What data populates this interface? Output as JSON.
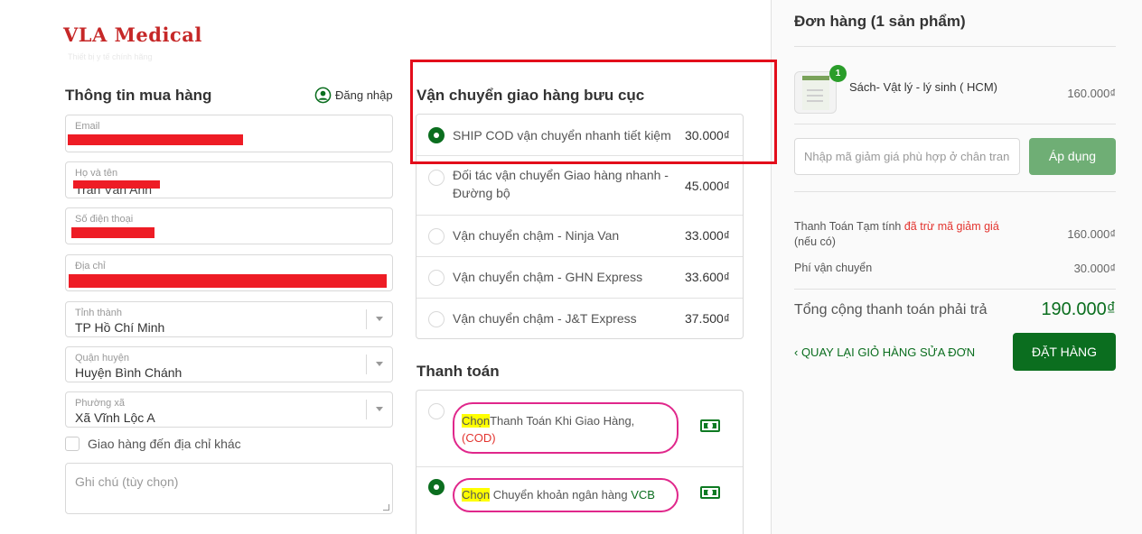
{
  "brand": {
    "logo": "VLA Medical",
    "tagline": "Thiết bị y tế chính hãng"
  },
  "checkout_info": {
    "title": "Thông tin mua hàng",
    "login_label": "Đăng nhập",
    "fields": {
      "email_label": "Email",
      "name_label": "Họ và tên",
      "name_value": "Trần Văn Anh",
      "phone_label": "Số điện thoại",
      "address_label": "Địa chỉ",
      "province_label": "Tỉnh thành",
      "province_value": "TP Hồ Chí Minh",
      "district_label": "Quận huyện",
      "district_value": "Huyện Bình Chánh",
      "ward_label": "Phường xã",
      "ward_value": "Xã Vĩnh Lộc A"
    },
    "other_address_label": "Giao hàng đến địa chỉ khác",
    "note_placeholder": "Ghi chú (tùy chọn)"
  },
  "shipping": {
    "title": "Vận chuyển giao hàng bưu cục",
    "options": [
      {
        "name": "SHIP COD vận chuyển nhanh tiết kiệm",
        "price": "30.000₫",
        "selected": true
      },
      {
        "name": "Đối tác vận chuyển Giao hàng nhanh - Đường bộ",
        "price": "45.000₫",
        "selected": false
      },
      {
        "name": "Vận chuyển chậm - Ninja Van",
        "price": "33.000₫",
        "selected": false
      },
      {
        "name": "Vận chuyển chậm - GHN Express",
        "price": "33.600₫",
        "selected": false
      },
      {
        "name": "Vận chuyển chậm - J&T Express",
        "price": "37.500₫",
        "selected": false
      }
    ]
  },
  "payment": {
    "title": "Thanh toán",
    "options": [
      {
        "choose": "Chọn",
        "label": "Thanh Toán Khi Giao Hàng,",
        "sublabel": "(COD)",
        "selected": false
      },
      {
        "choose": "Chọn",
        "label": " Chuyển khoản ngân hàng ",
        "bank": "VCB",
        "selected": true
      }
    ]
  },
  "order": {
    "title": "Đơn hàng (1 sản phẩm)",
    "item": {
      "qty": "1",
      "name": "Sách- Vật lý - lý sinh ( HCM)",
      "price": "160.000₫"
    },
    "coupon_placeholder": "Nhập mã giảm giá phù hợp ở chân trang",
    "apply_label": "Áp dụng",
    "subtotal_label": "Thanh Toán Tạm tính ",
    "subtotal_note": "đã trừ mã giảm giá",
    "subtotal_note2": "(nếu có)",
    "subtotal_value": "160.000₫",
    "shipping_label": "Phí vận chuyển",
    "shipping_value": "30.000₫",
    "total_label": "Tổng cộng thanh toán phải trả",
    "total_value": "190.000₫",
    "back_label": "‹ QUAY LẠI GIỎ HÀNG SỬA ĐƠN",
    "place_order_label": "ĐẶT HÀNG"
  },
  "colors": {
    "accent_green": "#0b6e1f",
    "highlight_red": "#e30d1b",
    "pill_pink": "#e0278b"
  }
}
